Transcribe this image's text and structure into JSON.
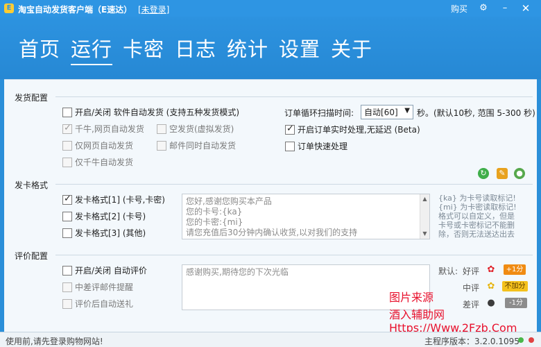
{
  "window": {
    "title": "淘宝自动发货客户端（E速达）",
    "login_link": "[未登录]",
    "buy_label": "购买",
    "gear_icon": "gear-icon",
    "minimize_glyph": "–",
    "close_glyph": "✕"
  },
  "nav": {
    "tabs": [
      {
        "label": "首页",
        "active": false
      },
      {
        "label": "运行",
        "active": true
      },
      {
        "label": "卡密",
        "active": false
      },
      {
        "label": "日志",
        "active": false
      },
      {
        "label": "统计",
        "active": false
      },
      {
        "label": "设置",
        "active": false
      },
      {
        "label": "关于",
        "active": false
      }
    ]
  },
  "delivery": {
    "section_title": "发货配置",
    "auto_delivery": {
      "label": "开启/关闭 软件自动发货 (支持五种发货模式)",
      "checked": false
    },
    "mode_qianniu_web": {
      "label": "千牛,网页自动发货",
      "checked": true,
      "disabled": true
    },
    "mode_empty": {
      "label": "空发货(虚拟发货)",
      "checked": false,
      "disabled": true
    },
    "mode_web_only": {
      "label": "仅网页自动发货",
      "checked": false,
      "disabled": true
    },
    "mode_mail": {
      "label": "邮件同时自动发货",
      "checked": false,
      "disabled": true
    },
    "mode_qianniu_only": {
      "label": "仅千牛自动发货",
      "checked": false,
      "disabled": true
    },
    "scan_label": "订单循环扫描时间:",
    "scan_value": "自动[60]",
    "scan_hint": "秒。(默认10秒, 范围 5-300 秒)",
    "realtime": {
      "label": "开启订单实时处理,无延迟 (Beta)",
      "checked": true
    },
    "fast": {
      "label": "订单快速处理",
      "checked": false
    }
  },
  "card_format": {
    "section_title": "发卡格式",
    "formats": [
      {
        "label": "发卡格式[1] (卡号,卡密)",
        "checked": true
      },
      {
        "label": "发卡格式[2] (卡号)",
        "checked": false
      },
      {
        "label": "发卡格式[3] (其他)",
        "checked": false
      }
    ],
    "template_lines": [
      "您好,感谢您购买本产品",
      "您的卡号:{ka}",
      "您的卡密:{mi}",
      "请您充值后30分钟内确认收货,以对我们的支持"
    ],
    "hint_lines": [
      "{ka} 为卡号读取标记!",
      "{mi} 为卡密读取标记!",
      "格式可以自定义，但是",
      "卡号或卡密标记不能删",
      "除，否则无法送达出去"
    ]
  },
  "review": {
    "section_title": "评价配置",
    "auto_review": {
      "label": "开启/关闭 自动评价",
      "checked": false
    },
    "mail_reminder": {
      "label": "中差评邮件提醒",
      "checked": false,
      "disabled": true
    },
    "gift": {
      "label": "评价后自动送礼",
      "checked": false,
      "disabled": true
    },
    "textarea_text": "感谢购买,期待您的下次光临",
    "default_label": "默认:",
    "good_label": "好评",
    "good_badge": "+1分",
    "mid_label": "中评",
    "mid_badge": "不加分",
    "bad_label": "差评",
    "bad_badge": "-1分"
  },
  "watermark": {
    "line1": "图片来源",
    "line2": "酒入辅助网",
    "line3": "Https://Www.2Fzb.Com"
  },
  "status": {
    "left": "使用前,请先登录购物网站!",
    "right": "主程序版本：3.2.0.1095"
  },
  "colors": {
    "accent": "#2b8fd9",
    "panel": "#f3f8fc",
    "good_badge": "#f08b12",
    "mid_badge": "#f4c11c",
    "bad_badge": "#8c8c8c",
    "watermark": "#e8112d"
  }
}
